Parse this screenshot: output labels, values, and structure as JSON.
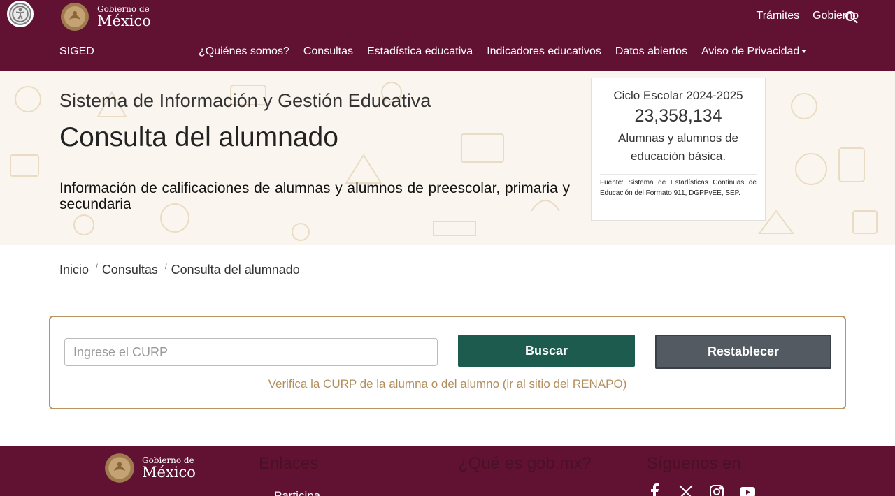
{
  "header": {
    "logo_small": "Gobierno de",
    "logo_big": "México",
    "top_links": [
      "Trámites",
      "Gobierno"
    ]
  },
  "navbar": {
    "brand": "SIGED",
    "items": [
      "¿Quiénes somos?",
      "Consultas",
      "Estadística educativa",
      "Indicadores educativos",
      "Datos abiertos",
      "Aviso de Privacidad"
    ]
  },
  "hero": {
    "subtitle": "Sistema de Información y Gestión Educativa",
    "title": "Consulta del alumnado",
    "description": "Información de calificaciones de alumnas y alumnos de preescolar, primaria y secundaria"
  },
  "stat_card": {
    "cycle": "Ciclo Escolar 2024-2025",
    "number": "23,358,134",
    "label": "Alumnas y alumnos de educación básica.",
    "source": "Fuente: Sistema de Estadísticas Continuas de Educación del Formato 911, DGPPyEE, SEP."
  },
  "breadcrumb": [
    "Inicio",
    "Consultas",
    "Consulta del alumnado"
  ],
  "search": {
    "placeholder": "Ingrese el CURP",
    "search_label": "Buscar",
    "reset_label": "Restablecer",
    "renapo_link": "Verifica la CURP de la alumna o del alumno (ir al sitio del RENAPO)"
  },
  "footer": {
    "logo_small": "Gobierno de",
    "logo_big": "México",
    "headings": [
      "Enlaces",
      "¿Qué es gob.mx?",
      "Síguenos en"
    ],
    "first_link": "Participa"
  },
  "colors": {
    "brand": "#611232",
    "gold": "#b38e5d",
    "green_button": "#1e5b4f",
    "gray_button": "#545a62"
  },
  "icons": [
    "accessibility-icon",
    "search-icon",
    "facebook-icon",
    "x-icon",
    "instagram-icon",
    "youtube-icon"
  ]
}
